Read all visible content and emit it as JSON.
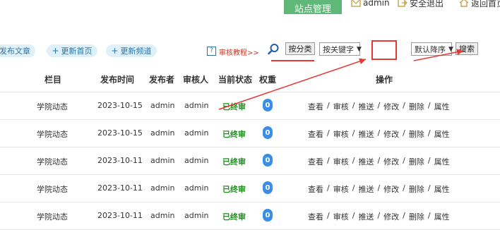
{
  "header": {
    "site_manage": "站点管理",
    "admin_link": "admin",
    "logout_link": "安全退出",
    "home_link": "返回首页"
  },
  "toolbar": {
    "publish_article": "发布文章",
    "update_home": "更新首页",
    "update_channel": "更新频道",
    "help_text": "审核教程>>",
    "by_category": "按分类",
    "keyword_select": "按关键字",
    "keyword_value": "",
    "order_select": "默认降序",
    "search_button": "搜索"
  },
  "table": {
    "headers": [
      "栏目",
      "发布时间",
      "发布者",
      "审核人",
      "当前状态",
      "权重",
      "操作"
    ],
    "rows": [
      {
        "column": "学院动态",
        "date": "2023-10-15",
        "publisher": "admin",
        "reviewer": "admin",
        "status": "已终审",
        "weight": "0"
      },
      {
        "column": "学院动态",
        "date": "2023-10-15",
        "publisher": "admin",
        "reviewer": "admin",
        "status": "已终审",
        "weight": "0"
      },
      {
        "column": "学院动态",
        "date": "2023-10-11",
        "publisher": "admin",
        "reviewer": "admin",
        "status": "已终审",
        "weight": "0"
      },
      {
        "column": "学院动态",
        "date": "2023-10-11",
        "publisher": "admin",
        "reviewer": "admin",
        "status": "已终审",
        "weight": "0"
      },
      {
        "column": "学院动态",
        "date": "2023-10-11",
        "publisher": "admin",
        "reviewer": "admin",
        "status": "已终审",
        "weight": "0"
      }
    ],
    "actions": [
      "查看",
      "审核",
      "推送",
      "修改",
      "删除",
      "属性"
    ]
  },
  "colors": {
    "site_manage_bg": "#5fb878",
    "status_green": "#1e8f1e",
    "badge_blue": "#3a8ee6",
    "annotation_red": "#e53935"
  },
  "icons": [
    "search-icon",
    "help-icon",
    "envelope-icon",
    "logout-icon",
    "home-icon"
  ]
}
